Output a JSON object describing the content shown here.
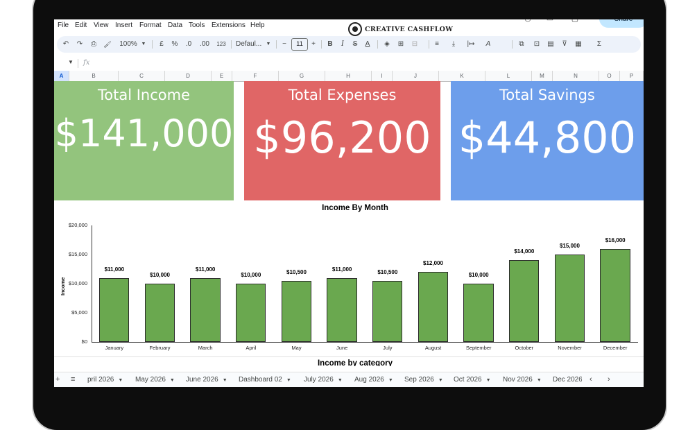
{
  "menu": [
    "File",
    "Edit",
    "View",
    "Insert",
    "Format",
    "Data",
    "Tools",
    "Extensions",
    "Help"
  ],
  "brand": {
    "name": "CREATIVE CASHFLOW"
  },
  "share_label": "Share",
  "toolbar": {
    "undo": "↶",
    "redo": "↷",
    "print": "⎙",
    "paint_format": "🖌",
    "zoom": "100%",
    "currency": "£",
    "percent": "%",
    "decrease_decimal": ".0",
    "increase_decimal": ".00",
    "number_format": "123",
    "font": "Defaul...",
    "font_size": "11",
    "bold": "B",
    "italic": "I",
    "strikethrough": "S",
    "text_color": "A",
    "fill_color": "◈",
    "borders": "⊞",
    "merge": "⊟",
    "h_align": "≡",
    "v_align": "⤓",
    "wrap": "|↦",
    "rotate": "A",
    "link": "⧉",
    "comment": "⊡",
    "chart": "▤",
    "filter": "⊽",
    "filter_views": "▦",
    "functions": "Σ"
  },
  "formula_bar": {
    "fx": "fx"
  },
  "columns": [
    "A",
    "B",
    "C",
    "D",
    "E",
    "F",
    "G",
    "H",
    "I",
    "J",
    "K",
    "L",
    "M",
    "N",
    "O",
    "P"
  ],
  "selected_column": "A",
  "cards": {
    "income": {
      "title": "Total Income",
      "value": "$141,000",
      "color": "#93c47d"
    },
    "expenses": {
      "title": "Total Expenses",
      "value": "$96,200",
      "color": "#e06666"
    },
    "savings": {
      "title": "Total Savings",
      "value": "$44,800",
      "color": "#6d9eeb"
    }
  },
  "chart_data": {
    "type": "bar",
    "title": "Income By Month",
    "ylabel": "Income",
    "xlabel": "",
    "categories": [
      "January",
      "February",
      "March",
      "April",
      "May",
      "June",
      "July",
      "August",
      "September",
      "October",
      "November",
      "December"
    ],
    "values": [
      11000,
      10000,
      11000,
      10000,
      10500,
      11000,
      10500,
      12000,
      10000,
      14000,
      15000,
      16000
    ],
    "value_labels": [
      "$11,000",
      "$10,000",
      "$11,000",
      "$10,000",
      "$10,500",
      "$11,000",
      "$10,500",
      "$12,000",
      "$10,000",
      "$14,000",
      "$15,000",
      "$16,000"
    ],
    "y_ticks": [
      "$0",
      "$5,000",
      "$10,000",
      "$15,000",
      "$20,000"
    ],
    "ylim": [
      0,
      20000
    ],
    "bar_color": "#6aa84f",
    "grid": false,
    "legend": "none"
  },
  "next_chart_title": "Income by category",
  "tabs": [
    "pril 2026",
    "May 2026",
    "June 2026",
    "Dashboard 02",
    "July 2026",
    "Aug 2026",
    "Sep 2026",
    "Oct 2026",
    "Nov 2026",
    "Dec 2026"
  ],
  "tab_controls": {
    "add": "+",
    "all_sheets": "≡",
    "prev": "‹",
    "next": "›"
  }
}
